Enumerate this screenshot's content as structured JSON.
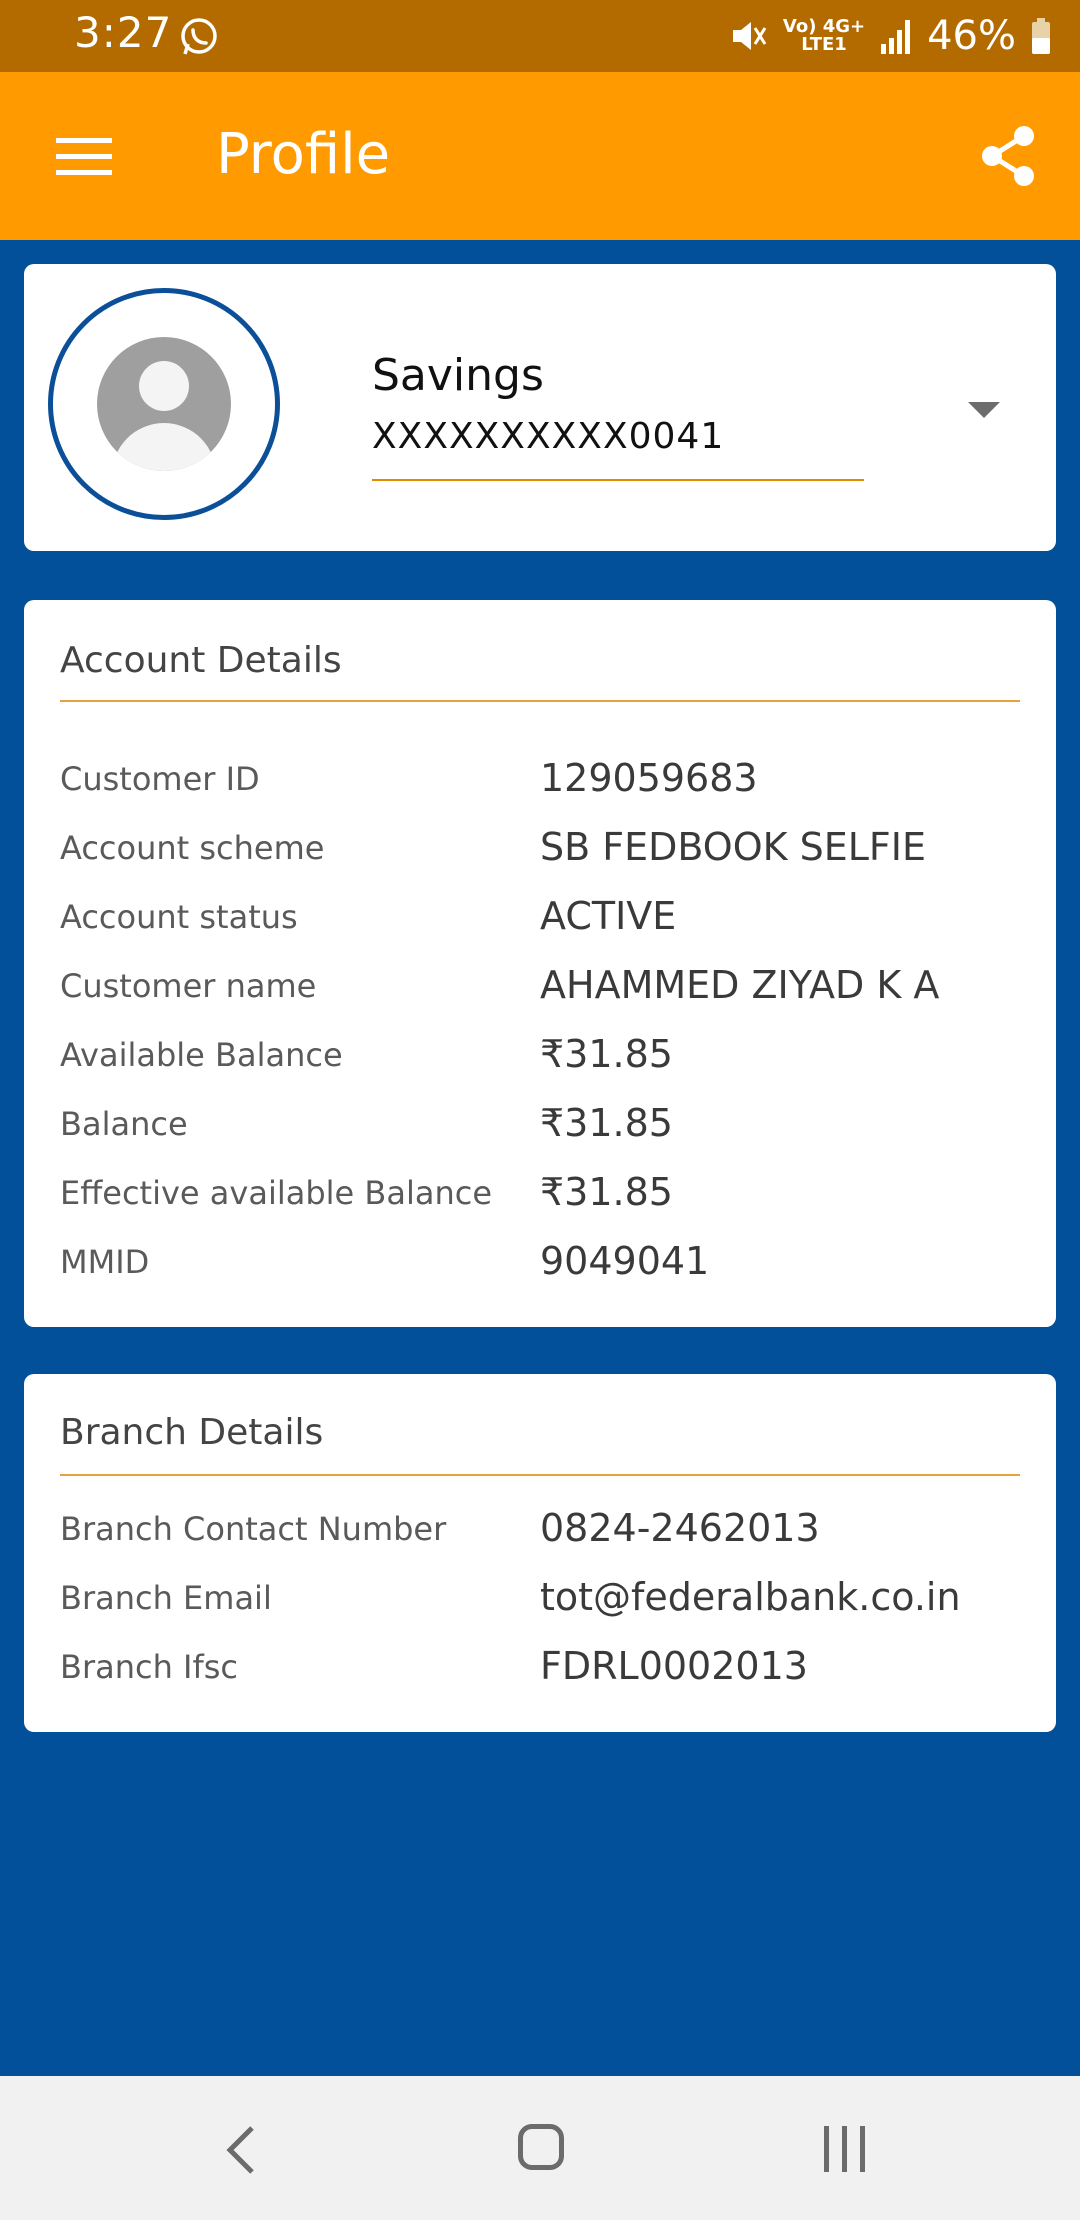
{
  "status_bar": {
    "time": "3:27",
    "network_top": "Vo) 4G+",
    "network_bottom": "LTE1",
    "battery": "46%"
  },
  "app_bar": {
    "title": "Profile",
    "color": "#ff9a00"
  },
  "account": {
    "type": "Savings",
    "number": "XXXXXXXXXX0041"
  },
  "account_details": {
    "title": "Account Details",
    "rows": [
      {
        "label": "Customer ID",
        "value": "129059683"
      },
      {
        "label": "Account scheme",
        "value": "SB FEDBOOK SELFIE"
      },
      {
        "label": "Account status",
        "value": "ACTIVE"
      },
      {
        "label": "Customer name",
        "value": "AHAMMED ZIYAD K A"
      },
      {
        "label": "Available Balance",
        "value": "₹31.85"
      },
      {
        "label": "Balance",
        "value": "₹31.85"
      },
      {
        "label": "Effective available Balance",
        "value": "₹31.85"
      },
      {
        "label": "MMID",
        "value": "9049041"
      }
    ]
  },
  "branch_details": {
    "title": "Branch Details",
    "rows": [
      {
        "label": "Branch Contact Number",
        "value": "0824-2462013"
      },
      {
        "label": "Branch Email",
        "value": "tot@federalbank.co.in"
      },
      {
        "label": "Branch Ifsc",
        "value": "FDRL0002013"
      }
    ]
  },
  "colors": {
    "background": "#03509a",
    "accent": "#ff9a00",
    "status_bar": "#b36b00"
  },
  "icons": [
    "whatsapp-icon",
    "mute-icon",
    "signal-icon",
    "battery-icon",
    "menu-icon",
    "share-icon",
    "avatar-icon",
    "dropdown-icon",
    "back-icon",
    "home-icon",
    "recent-apps-icon"
  ]
}
